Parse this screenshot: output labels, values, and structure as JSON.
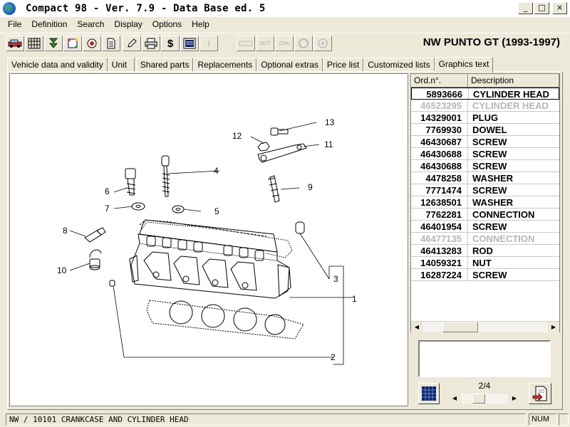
{
  "app": {
    "title": "Compact 98  -  Ver. 7.9  -  Data Base ed. 5",
    "window_buttons": {
      "minimize": "_",
      "maximize": "□",
      "close": "×"
    }
  },
  "menu": [
    "File",
    "Definition",
    "Search",
    "Display",
    "Options",
    "Help"
  ],
  "toolbar": {
    "buttons": [
      {
        "name": "vehicle-icon",
        "glyph": "🚗"
      },
      {
        "name": "grid-view-icon",
        "glyph": "▦"
      },
      {
        "name": "filter-icon",
        "glyph": "⧩"
      },
      {
        "name": "refresh-icon",
        "glyph": "⟳"
      },
      {
        "name": "target-icon",
        "glyph": "◉"
      },
      {
        "name": "document-icon",
        "glyph": "📄"
      },
      {
        "name": "edit-icon",
        "glyph": "✎"
      },
      {
        "name": "print-icon",
        "glyph": "🖶"
      },
      {
        "name": "price-icon",
        "glyph": "$"
      },
      {
        "name": "image-icon",
        "glyph": "▣"
      },
      {
        "name": "info-icon",
        "glyph": "i"
      }
    ],
    "disabled_labels": [
      "OUT",
      "Com"
    ]
  },
  "vehicle_title": "NW PUNTO GT (1993-1997)",
  "tabs": [
    "Vehicle data and validity",
    "Unit",
    "Shared parts",
    "Replacements",
    "Optional extras",
    "Price list",
    "Customized lists",
    "Graphics text"
  ],
  "active_tab": "Graphics text",
  "parts_table": {
    "headers": [
      "Ord.n°.",
      "Description"
    ],
    "rows": [
      {
        "ord": "5893666",
        "desc": "CYLINDER HEAD",
        "state": "selected"
      },
      {
        "ord": "46523295",
        "desc": "CYLINDER HEAD",
        "state": "dim"
      },
      {
        "ord": "14329001",
        "desc": "PLUG",
        "state": "normal"
      },
      {
        "ord": "7769930",
        "desc": "DOWEL",
        "state": "normal"
      },
      {
        "ord": "46430687",
        "desc": "SCREW",
        "state": "normal"
      },
      {
        "ord": "46430688",
        "desc": "SCREW",
        "state": "normal"
      },
      {
        "ord": "46430688",
        "desc": "SCREW",
        "state": "normal"
      },
      {
        "ord": "4478258",
        "desc": "WASHER",
        "state": "normal"
      },
      {
        "ord": "7771474",
        "desc": "SCREW",
        "state": "normal"
      },
      {
        "ord": "12638501",
        "desc": "WASHER",
        "state": "normal"
      },
      {
        "ord": "7762281",
        "desc": "CONNECTION",
        "state": "normal"
      },
      {
        "ord": "46401954",
        "desc": "SCREW",
        "state": "normal"
      },
      {
        "ord": "46477135",
        "desc": "CONNECTION",
        "state": "dim"
      },
      {
        "ord": "46413283",
        "desc": "ROD",
        "state": "normal"
      },
      {
        "ord": "14059321",
        "desc": "NUT",
        "state": "normal"
      },
      {
        "ord": "16287224",
        "desc": "SCREW",
        "state": "normal"
      }
    ]
  },
  "diagram_callouts": [
    "1",
    "2",
    "3",
    "4",
    "5",
    "6",
    "7",
    "8",
    "9",
    "10",
    "11",
    "12",
    "13"
  ],
  "page_indicator": "2/4",
  "status": {
    "text": "NW / 10101  CRANKCASE AND CYLINDER HEAD",
    "num": "NUM"
  },
  "colors": {
    "window_bg": "#ece9d8",
    "panel_bg": "#ffffff",
    "dim_text": "#b6b6b6"
  }
}
